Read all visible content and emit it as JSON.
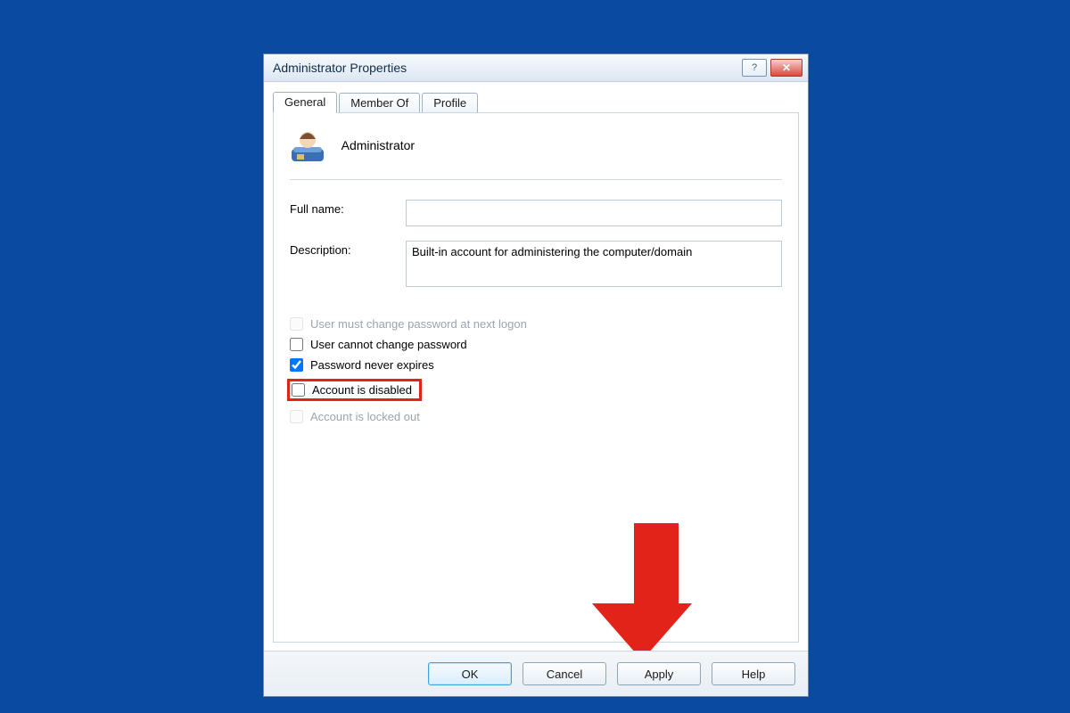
{
  "window": {
    "title": "Administrator Properties"
  },
  "tabs": {
    "general": "General",
    "memberof": "Member Of",
    "profile": "Profile"
  },
  "header": {
    "name": "Administrator"
  },
  "fields": {
    "fullname_label": "Full name:",
    "fullname_value": "",
    "description_label": "Description:",
    "description_value": "Built-in account for administering the computer/domain"
  },
  "checks": {
    "mustchange": "User must change password at next logon",
    "cannotchange": "User cannot change password",
    "neverexpires": "Password never expires",
    "disabled": "Account is disabled",
    "lockedout": "Account is locked out"
  },
  "buttons": {
    "ok": "OK",
    "cancel": "Cancel",
    "apply": "Apply",
    "help": "Help"
  },
  "colors": {
    "accent_red": "#e2231a",
    "bg_blue": "#0a4aa0"
  }
}
